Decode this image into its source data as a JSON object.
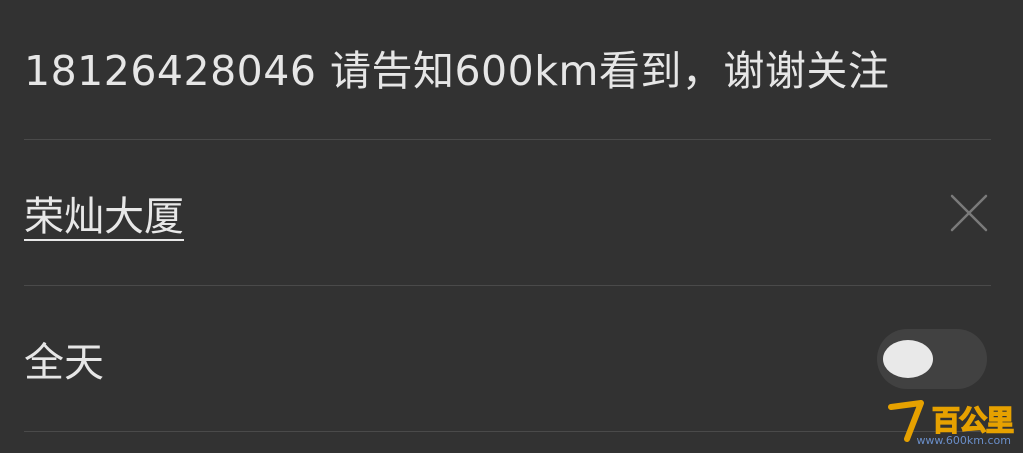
{
  "event": {
    "title": "18126428046 请告知600km看到，谢谢关注",
    "location": "荣灿大厦",
    "all_day_label": "全天",
    "all_day_enabled": false
  },
  "icons": {
    "clear": "close-icon",
    "toggle": "toggle-switch"
  },
  "colors": {
    "background": "#323232",
    "divider": "#4a4a4a",
    "text": "#e6e6e6",
    "toggle_track": "#414141",
    "toggle_knob": "#e9e9e9"
  },
  "watermark": {
    "logo_text": "百公里",
    "url": "www.600km.com"
  }
}
